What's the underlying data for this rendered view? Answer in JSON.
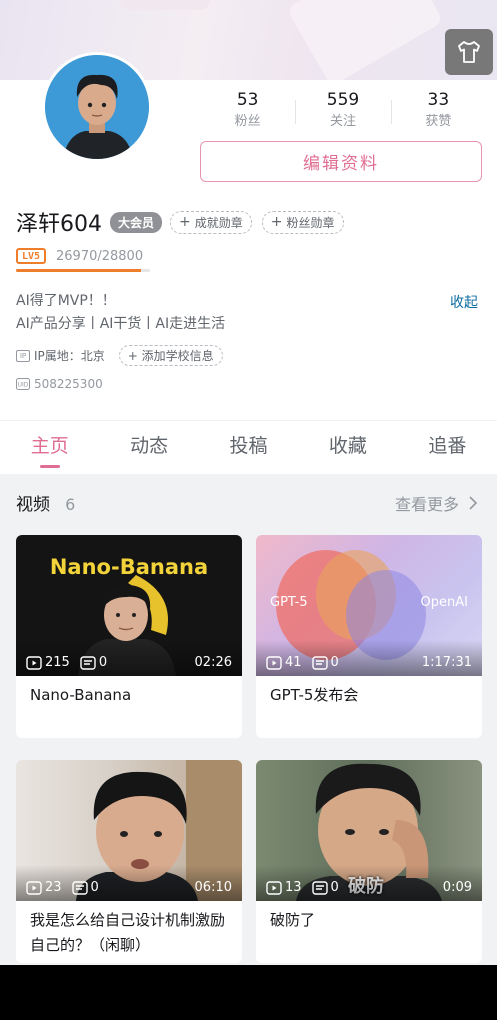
{
  "stats": [
    {
      "num": "53",
      "label": "粉丝"
    },
    {
      "num": "559",
      "label": "关注"
    },
    {
      "num": "33",
      "label": "获赞"
    }
  ],
  "edit_button": "编辑资料",
  "user": {
    "name": "泽轩604",
    "vip_badge": "大会员",
    "medal_achievement": "成就勋章",
    "medal_fans": "粉丝勋章",
    "level": "LV5",
    "exp": "26970/28800",
    "exp_progress": 0.936,
    "bio_line1": "AI得了MVP！！",
    "bio_line2": "AI产品分享丨AI干货丨AI走进生活",
    "collapse": "收起",
    "ip_label": "IP属地：北京",
    "add_school": "添加学校信息",
    "uid": "508225300"
  },
  "tabs": [
    "主页",
    "动态",
    "投稿",
    "收藏",
    "追番"
  ],
  "videos_section": {
    "title": "视频",
    "count": "6",
    "see_more": "查看更多"
  },
  "videos": [
    {
      "plays": "215",
      "danmaku": "0",
      "duration": "02:26",
      "title": "Nano-Banana",
      "thumb_text": "Nano-Banana"
    },
    {
      "plays": "41",
      "danmaku": "0",
      "duration": "1:17:31",
      "title": "GPT-5发布会",
      "thumb_text_left": "GPT-5",
      "thumb_text_right": "OpenAI"
    },
    {
      "plays": "23",
      "danmaku": "0",
      "duration": "06:10",
      "title": "我是怎么给自己设计机制激励自己的？（闲聊）"
    },
    {
      "plays": "13",
      "danmaku": "0",
      "duration": "0:09",
      "title": "破防了",
      "thumb_text": "破防"
    }
  ],
  "colors": {
    "accent": "#e06e92",
    "level": "#ef7e2c",
    "link": "#0d6ca0"
  }
}
